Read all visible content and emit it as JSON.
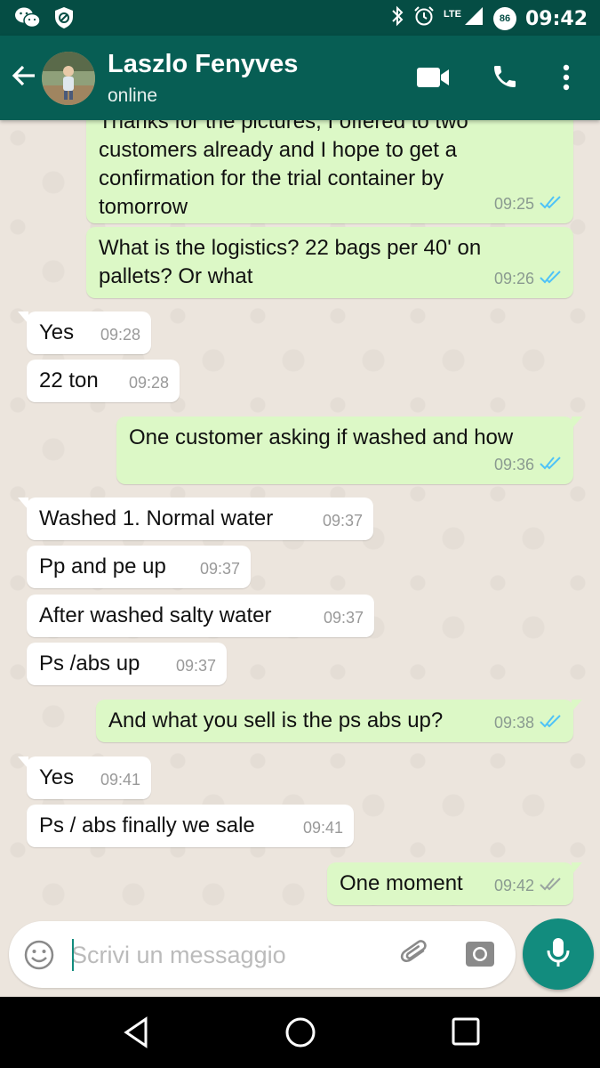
{
  "status_bar": {
    "time": "09:42",
    "network": "LTE",
    "battery": "86",
    "icons": [
      "wechat-icon",
      "vpn-shield-icon",
      "bluetooth-icon",
      "alarm-icon",
      "signal-icon",
      "battery-icon"
    ]
  },
  "header": {
    "contact_name": "Laszlo Fenyves",
    "status": "online",
    "icons": [
      "back-arrow-icon",
      "video-call-icon",
      "phone-icon",
      "more-vert-icon"
    ]
  },
  "messages": [
    {
      "dir": "out",
      "lines": [
        "Thanks for the pictures, I offered to two",
        "customers already and I hope to get a",
        "confirmation for the trial container by",
        "tomorrow"
      ],
      "time": "09:25",
      "ticks": "read"
    },
    {
      "dir": "out",
      "lines": [
        "What is the logistics? 22 bags per 40' on",
        "pallets? Or what"
      ],
      "time": "09:26",
      "ticks": "read"
    },
    {
      "dir": "in",
      "lines": [
        "Yes"
      ],
      "time": "09:28"
    },
    {
      "dir": "in",
      "lines": [
        "22 ton"
      ],
      "time": "09:28"
    },
    {
      "dir": "out",
      "lines": [
        "One customer asking if washed and how"
      ],
      "time": "09:36",
      "ticks": "read"
    },
    {
      "dir": "in",
      "lines": [
        "Washed 1. Normal water"
      ],
      "time": "09:37"
    },
    {
      "dir": "in",
      "lines": [
        "Pp and pe up"
      ],
      "time": "09:37"
    },
    {
      "dir": "in",
      "lines": [
        "After washed salty water"
      ],
      "time": "09:37"
    },
    {
      "dir": "in",
      "lines": [
        "Ps /abs up"
      ],
      "time": "09:37"
    },
    {
      "dir": "out",
      "lines": [
        "And what you sell is the ps abs up?"
      ],
      "time": "09:38",
      "ticks": "read"
    },
    {
      "dir": "in",
      "lines": [
        "Yes"
      ],
      "time": "09:41"
    },
    {
      "dir": "in",
      "lines": [
        "Ps / abs finally we sale"
      ],
      "time": "09:41"
    },
    {
      "dir": "out",
      "lines": [
        "One moment"
      ],
      "time": "09:42",
      "ticks": "delivered"
    }
  ],
  "composer": {
    "placeholder": "Scrivi un messaggio",
    "icons": [
      "emoji-icon",
      "attach-icon",
      "camera-icon",
      "mic-icon"
    ]
  },
  "colors": {
    "status_bar": "#054d44",
    "app_bar": "#075e54",
    "outgoing_bubble": "#dcf8c6",
    "incoming_bubble": "#ffffff",
    "accent": "#128c7e",
    "read_ticks": "#4fc3f7",
    "delivered_ticks": "#9aa5a0"
  }
}
